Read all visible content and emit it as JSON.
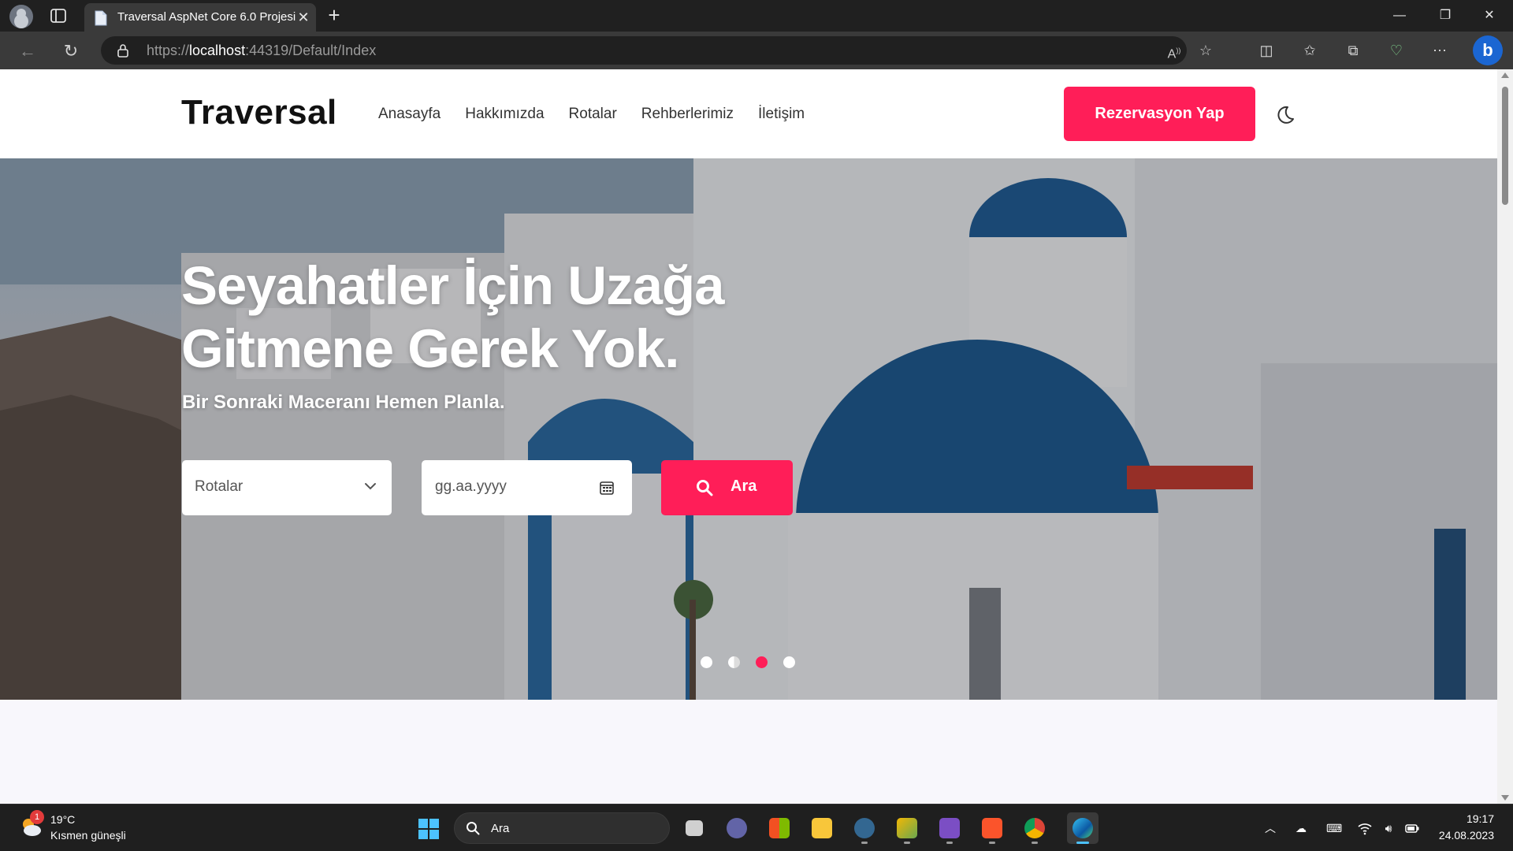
{
  "browser": {
    "tab_title": "Traversal AspNet Core 6.0 Projesi",
    "url_prefix": "https://",
    "url_host": "localhost",
    "url_rest": ":44319/Default/Index"
  },
  "site": {
    "brand": "Traversal",
    "nav": [
      "Anasayfa",
      "Hakkımızda",
      "Rotalar",
      "Rehberlerimiz",
      "İletişim"
    ],
    "cta_label": "Rezervasyon Yap",
    "accent_color": "#ff1e58"
  },
  "hero": {
    "headline": "Seyahatler İçin Uzağa Gitmene Gerek Yok.",
    "subline": "Bir Sonraki Maceranı Hemen Planla.",
    "route_select": "Rotalar",
    "date_placeholder": "gg.aa.yyyy",
    "search_label": "Ara",
    "slides": {
      "count": 4,
      "active_index": 2
    }
  },
  "taskbar": {
    "weather_badge": "1",
    "temperature": "19°C",
    "condition": "Kısmen güneşli",
    "search_label": "Ara",
    "time": "19:17",
    "date": "24.08.2023"
  }
}
